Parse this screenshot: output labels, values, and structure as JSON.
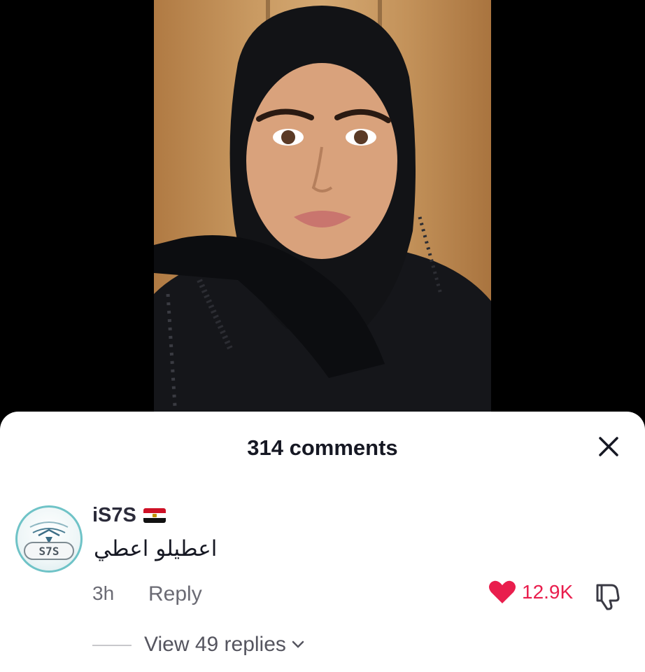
{
  "video": {
    "background_color": "#000000",
    "frame_colors": [
      "#b07a43",
      "#d4a872"
    ]
  },
  "comments_sheet": {
    "title": "314 comments",
    "close_icon": "close-icon"
  },
  "comment": {
    "username": "iS7S",
    "flag_icon": "egypt-flag-icon",
    "avatar_text": "S7S",
    "text": "اعطيلو اعطي",
    "time": "3h",
    "reply_label": "Reply",
    "like_icon": "heart-icon",
    "like_count": "12.9K",
    "like_color": "#e91e4d",
    "dislike_icon": "thumbs-down-icon"
  },
  "replies": {
    "label": "View 49 replies",
    "icon": "chevron-down-icon"
  }
}
